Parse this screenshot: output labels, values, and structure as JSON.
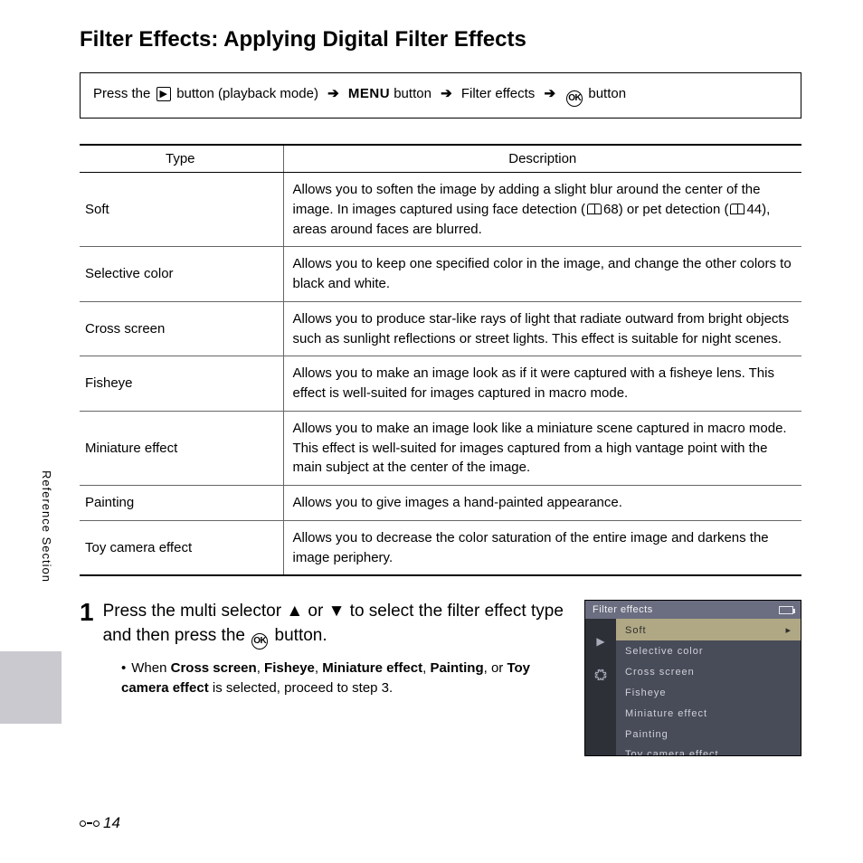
{
  "side_label": "Reference Section",
  "title": "Filter Effects: Applying Digital Filter Effects",
  "nav": {
    "press_the": "Press the",
    "playback_mode": "button (playback mode)",
    "menu": "MENU",
    "button_after_menu": "button",
    "filter_effects": "Filter effects",
    "button_final": "button"
  },
  "table": {
    "headers": [
      "Type",
      "Description"
    ],
    "rows": [
      {
        "type": "Soft",
        "desc_a": "Allows you to soften the image by adding a slight blur around the center of the image. In images captured using face detection (",
        "ref1": "68",
        "desc_b": ") or pet detection (",
        "ref2": "44",
        "desc_c": "), areas around faces are blurred."
      },
      {
        "type": "Selective color",
        "desc": "Allows you to keep one specified color in the image, and change the other colors to black and white."
      },
      {
        "type": "Cross screen",
        "desc": "Allows you to produce star-like rays of light that radiate outward from bright objects such as sunlight reflections or street lights. This effect is suitable for night scenes."
      },
      {
        "type": "Fisheye",
        "desc": "Allows you to make an image look as if it were captured with a fisheye lens. This effect is well-suited for images captured in macro mode."
      },
      {
        "type": "Miniature effect",
        "desc": "Allows you to make an image look like a miniature scene captured in macro mode. This effect is well-suited for images captured from a high vantage point with the main subject at the center of the image."
      },
      {
        "type": "Painting",
        "desc": "Allows you to give images a hand-painted appearance."
      },
      {
        "type": "Toy camera effect",
        "desc": "Allows you to decrease the color saturation of the entire image and darkens the image periphery."
      }
    ]
  },
  "step": {
    "num": "1",
    "head_a": "Press the multi selector ",
    "head_b": " or ",
    "head_c": " to select the filter effect type and then press the ",
    "head_d": " button.",
    "sub_a": "When ",
    "bold": [
      "Cross screen",
      "Fisheye",
      "Miniature effect",
      "Painting",
      "Toy camera effect"
    ],
    "sub_joins": [
      ", ",
      ", ",
      ", ",
      ", or "
    ],
    "sub_b": " is selected, proceed to step 3."
  },
  "lcd": {
    "title": "Filter effects",
    "items": [
      "Soft",
      "Selective color",
      "Cross screen",
      "Fisheye",
      "Miniature effect",
      "Painting",
      "Toy camera effect"
    ]
  },
  "page_number": "14"
}
